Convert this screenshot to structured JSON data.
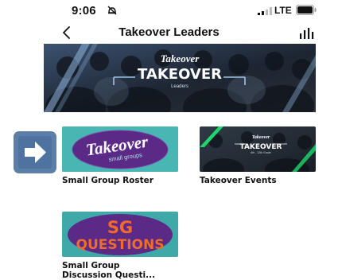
{
  "status_bar": {
    "time": "9:06",
    "network": "LTE",
    "icons": [
      "do-not-disturb-icon",
      "signal-icon",
      "battery-icon"
    ]
  },
  "nav": {
    "title": "Takeover Leaders",
    "back_icon": "chevron-left-icon",
    "right_icon": "bar-chart-icon"
  },
  "hero": {
    "script_word": "Takeover",
    "title": "TAKEOVER",
    "subtitle": "Leaders"
  },
  "side_button": {
    "icon": "arrow-right-icon"
  },
  "tiles": [
    {
      "label": "Small Group Roster",
      "image_script": "Takeover",
      "image_subtitle": "small groups"
    },
    {
      "label": "Takeover Events",
      "image_script": "Takeover",
      "image_title": "TAKEOVER",
      "image_subtitle": "6th - 12th Grade"
    },
    {
      "label": "Small Group\nDiscussion Questi...",
      "image_line1": "SG",
      "image_line2": "QUESTIONS"
    }
  ],
  "colors": {
    "accent_blue": "#5c7fa8",
    "purple": "#5b2a86",
    "teal": "#3fa9a9",
    "orange": "#f26b2b",
    "green": "#1ed76a"
  }
}
